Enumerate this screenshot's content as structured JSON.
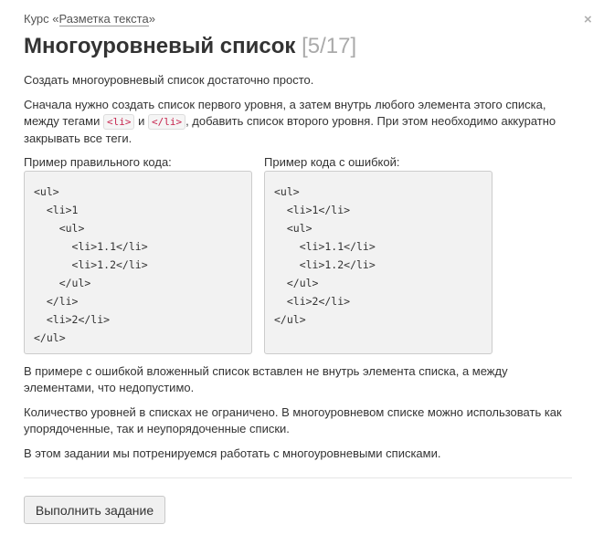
{
  "breadcrumb": {
    "prefix": "Курс «",
    "course_link": "Разметка текста",
    "suffix": "»"
  },
  "close_icon_glyph": "×",
  "header": {
    "title": "Многоуровневый список",
    "progress": "[5/17]"
  },
  "intro": "Создать многоуровневый список достаточно просто.",
  "instructions": {
    "part1": "Сначала нужно создать список первого уровня, а затем внутрь любого элемента этого списка, между тегами ",
    "tag_open": "<li>",
    "and": " и ",
    "tag_close": "</li>",
    "part2": ", добавить список второго уровня. При этом необходимо аккуратно закрывать все теги."
  },
  "examples": {
    "correct": {
      "caption": "Пример правильного кода:",
      "lines": [
        "<ul>",
        "  <li>1",
        "    <ul>",
        "      <li>1.1</li>",
        "      <li>1.2</li>",
        "    </ul>",
        "  </li>",
        "  <li>2</li>",
        "</ul>"
      ]
    },
    "wrong": {
      "caption": "Пример кода с ошибкой:",
      "lines": [
        "<ul>",
        "  <li>1</li>",
        "  <ul>",
        "    <li>1.1</li>",
        "    <li>1.2</li>",
        "  </ul>",
        "  <li>2</li>",
        "</ul>"
      ]
    }
  },
  "error_note": "В примере с ошибкой вложенный список вставлен не внутрь элемента списка, а между элементами, что недопустимо.",
  "levels_note": "Количество уровней в списках не ограничено. В многоуровневом списке можно использовать как упорядоченные, так и неупорядоченные списки.",
  "task_note": "В этом задании мы потренируемся работать с многоуровневыми списками.",
  "actions": {
    "start_label": "Выполнить задание"
  }
}
